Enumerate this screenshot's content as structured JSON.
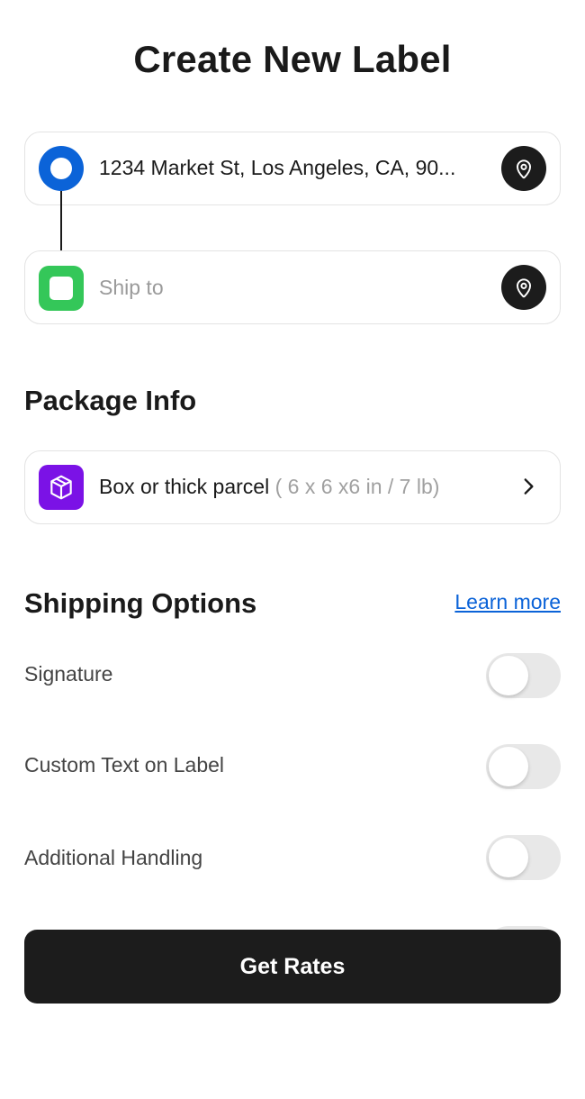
{
  "header": {
    "title": "Create New Label"
  },
  "route": {
    "from": {
      "value": "1234 Market St, Los Angeles, CA, 90...",
      "icon": "origin-circle-icon",
      "color": "#0b63d8"
    },
    "to": {
      "placeholder": "Ship to",
      "value": "",
      "icon": "destination-square-icon",
      "color": "#34c759"
    },
    "pin_icon": "map-pin-icon"
  },
  "package": {
    "section_title": "Package Info",
    "name": "Box or thick parcel",
    "dimensions": " ( 6 x 6 x6 in / 7 lb)",
    "icon": "package-box-icon",
    "icon_color": "#7b12e6"
  },
  "shipping": {
    "section_title": "Shipping Options",
    "learn_more": "Learn more",
    "options": [
      {
        "label": "Signature",
        "enabled": false
      },
      {
        "label": "Custom Text on Label",
        "enabled": false
      },
      {
        "label": "Additional Handling",
        "enabled": false
      }
    ]
  },
  "cta": {
    "label": "Get Rates"
  }
}
